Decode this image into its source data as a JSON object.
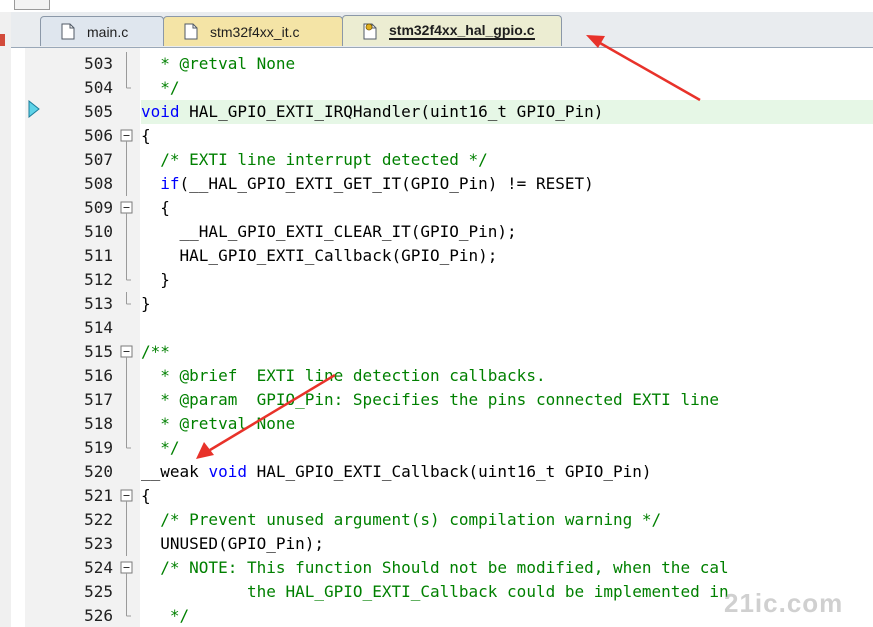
{
  "tabs": [
    {
      "label": "main.c",
      "state": "inactive",
      "icon": "c-file-icon"
    },
    {
      "label": "stm32f4xx_it.c",
      "state": "modified",
      "icon": "c-file-icon"
    },
    {
      "label": "stm32f4xx_hal_gpio.c",
      "state": "active",
      "icon": "c-file-pinned-icon"
    }
  ],
  "editor": {
    "current_line": 505,
    "lines": [
      {
        "n": "503",
        "fold": "line",
        "tokens": [
          {
            "t": "  * @retval None",
            "c": "comment"
          }
        ]
      },
      {
        "n": "504",
        "fold": "end",
        "tokens": [
          {
            "t": "  */",
            "c": "comment"
          }
        ]
      },
      {
        "n": "505",
        "fold": "none",
        "hl": true,
        "tokens": [
          {
            "t": "void",
            "c": "keyword"
          },
          {
            "t": " HAL_GPIO_EXTI_IRQHandler(uint16_t GPIO_Pin)",
            "c": "plain"
          }
        ]
      },
      {
        "n": "506",
        "fold": "box",
        "tokens": [
          {
            "t": "{",
            "c": "plain"
          }
        ]
      },
      {
        "n": "507",
        "fold": "line",
        "tokens": [
          {
            "t": "  /* EXTI line interrupt detected */",
            "c": "comment"
          }
        ]
      },
      {
        "n": "508",
        "fold": "line",
        "tokens": [
          {
            "t": "  ",
            "c": "plain"
          },
          {
            "t": "if",
            "c": "keyword"
          },
          {
            "t": "(__HAL_GPIO_EXTI_GET_IT(GPIO_Pin) != RESET)",
            "c": "plain"
          }
        ]
      },
      {
        "n": "509",
        "fold": "box",
        "tokens": [
          {
            "t": "  {",
            "c": "plain"
          }
        ]
      },
      {
        "n": "510",
        "fold": "line",
        "tokens": [
          {
            "t": "    __HAL_GPIO_EXTI_CLEAR_IT(GPIO_Pin);",
            "c": "plain"
          }
        ]
      },
      {
        "n": "511",
        "fold": "line",
        "tokens": [
          {
            "t": "    HAL_GPIO_EXTI_Callback(GPIO_Pin);",
            "c": "plain"
          }
        ]
      },
      {
        "n": "512",
        "fold": "end",
        "tokens": [
          {
            "t": "  }",
            "c": "plain"
          }
        ]
      },
      {
        "n": "513",
        "fold": "end",
        "tokens": [
          {
            "t": "}",
            "c": "plain"
          }
        ]
      },
      {
        "n": "514",
        "fold": "none",
        "tokens": [
          {
            "t": "",
            "c": "plain"
          }
        ]
      },
      {
        "n": "515",
        "fold": "box",
        "tokens": [
          {
            "t": "/**",
            "c": "comment"
          }
        ]
      },
      {
        "n": "516",
        "fold": "line",
        "tokens": [
          {
            "t": "  * @brief  EXTI line detection callbacks.",
            "c": "comment"
          }
        ]
      },
      {
        "n": "517",
        "fold": "line",
        "tokens": [
          {
            "t": "  * @param  GPIO_Pin: Specifies the pins connected EXTI line",
            "c": "comment"
          }
        ]
      },
      {
        "n": "518",
        "fold": "line",
        "tokens": [
          {
            "t": "  * @retval None",
            "c": "comment"
          }
        ]
      },
      {
        "n": "519",
        "fold": "end",
        "tokens": [
          {
            "t": "  */",
            "c": "comment"
          }
        ]
      },
      {
        "n": "520",
        "fold": "none",
        "tokens": [
          {
            "t": "__weak ",
            "c": "plain"
          },
          {
            "t": "void",
            "c": "keyword"
          },
          {
            "t": " HAL_GPIO_EXTI_Callback(uint16_t GPIO_Pin)",
            "c": "plain"
          }
        ]
      },
      {
        "n": "521",
        "fold": "box",
        "tokens": [
          {
            "t": "{",
            "c": "plain"
          }
        ]
      },
      {
        "n": "522",
        "fold": "line",
        "tokens": [
          {
            "t": "  /* Prevent unused argument(s) compilation warning */",
            "c": "comment"
          }
        ]
      },
      {
        "n": "523",
        "fold": "line",
        "tokens": [
          {
            "t": "  UNUSED(GPIO_Pin);",
            "c": "plain"
          }
        ]
      },
      {
        "n": "524",
        "fold": "box",
        "tokens": [
          {
            "t": "  /* NOTE: This function Should not be modified, when the cal",
            "c": "comment"
          }
        ]
      },
      {
        "n": "525",
        "fold": "line",
        "tokens": [
          {
            "t": "           the HAL_GPIO_EXTI_Callback could be implemented in",
            "c": "comment"
          }
        ]
      },
      {
        "n": "526",
        "fold": "end",
        "tokens": [
          {
            "t": "   */",
            "c": "comment"
          }
        ]
      }
    ]
  },
  "watermark": "21ic.com",
  "colors": {
    "comment": "#008000",
    "keyword": "#0000ff",
    "annotation_arrow": "#e8322a",
    "current_line": "#e6f7e6"
  }
}
